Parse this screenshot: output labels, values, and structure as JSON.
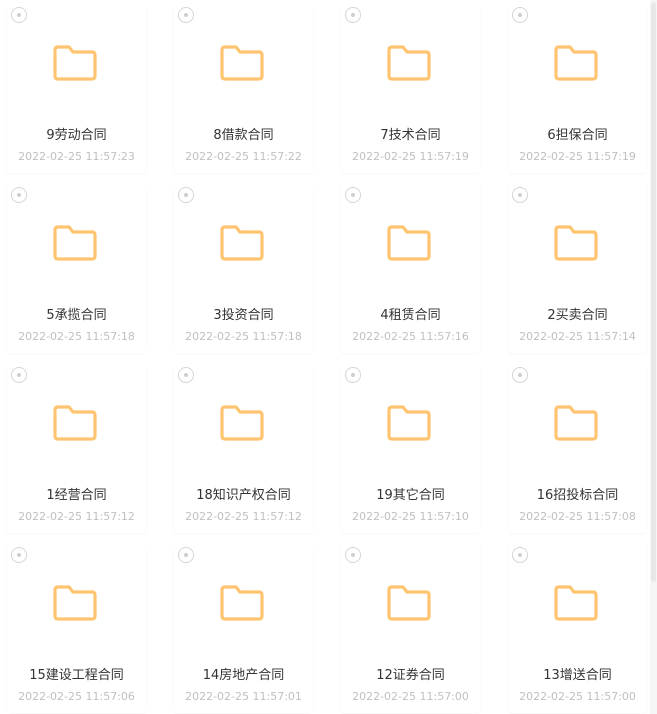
{
  "colors": {
    "folder_stroke": "#ffc46f",
    "name_text": "#333333",
    "time_text": "#c0c0c0"
  },
  "folders": [
    {
      "name": "9劳动合同",
      "time": "2022-02-25 11:57:23"
    },
    {
      "name": "8借款合同",
      "time": "2022-02-25 11:57:22"
    },
    {
      "name": "7技术合同",
      "time": "2022-02-25 11:57:19"
    },
    {
      "name": "6担保合同",
      "time": "2022-02-25 11:57:19"
    },
    {
      "name": "5承揽合同",
      "time": "2022-02-25 11:57:18"
    },
    {
      "name": "3投资合同",
      "time": "2022-02-25 11:57:18"
    },
    {
      "name": "4租赁合同",
      "time": "2022-02-25 11:57:16"
    },
    {
      "name": "2买卖合同",
      "time": "2022-02-25 11:57:14"
    },
    {
      "name": "1经营合同",
      "time": "2022-02-25 11:57:12"
    },
    {
      "name": "18知识产权合同",
      "time": "2022-02-25 11:57:12"
    },
    {
      "name": "19其它合同",
      "time": "2022-02-25 11:57:10"
    },
    {
      "name": "16招投标合同",
      "time": "2022-02-25 11:57:08"
    },
    {
      "name": "15建设工程合同",
      "time": "2022-02-25 11:57:06"
    },
    {
      "name": "14房地产合同",
      "time": "2022-02-25 11:57:01"
    },
    {
      "name": "12证券合同",
      "time": "2022-02-25 11:57:00"
    },
    {
      "name": "13增送合同",
      "time": "2022-02-25 11:57:00"
    }
  ]
}
